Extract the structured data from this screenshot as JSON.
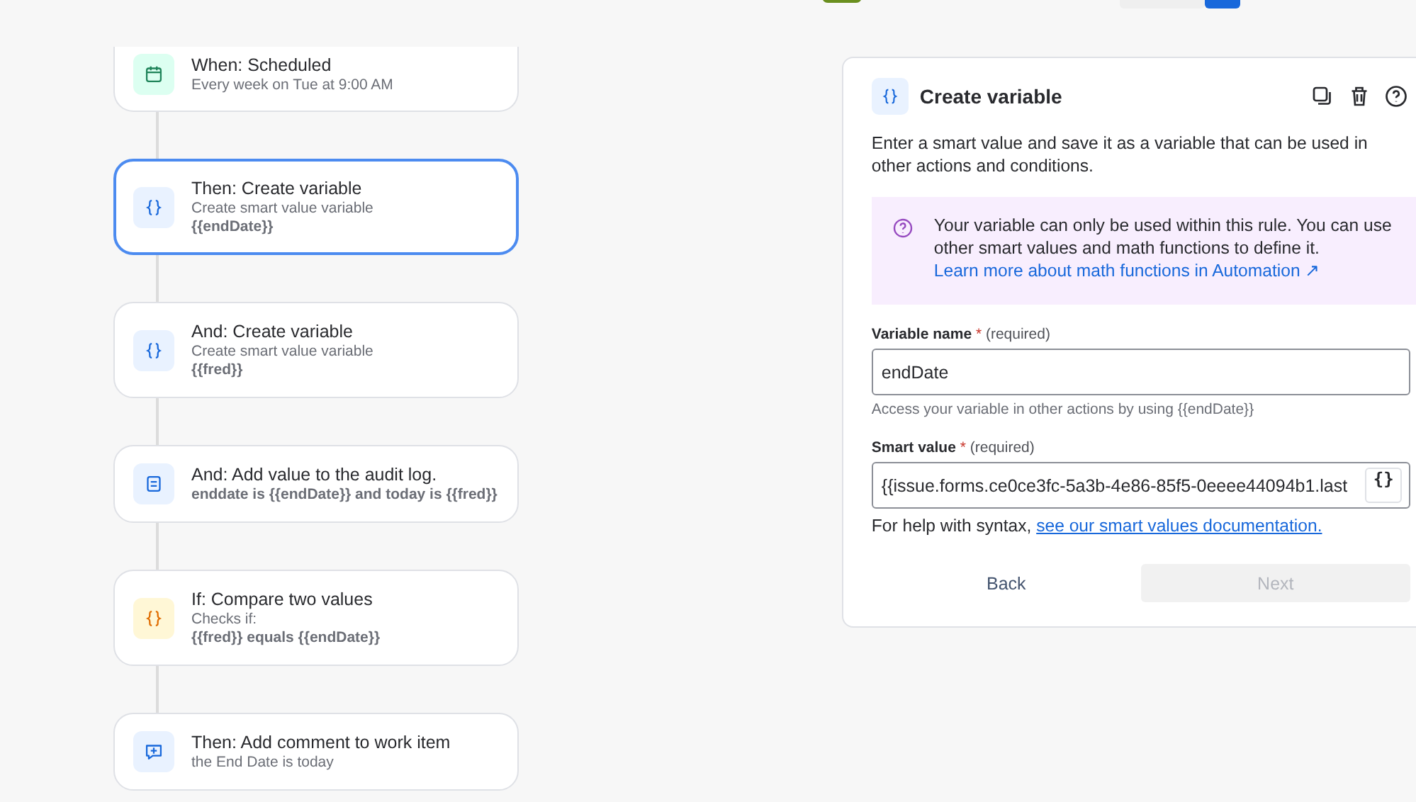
{
  "steps": [
    {
      "kind": "schedule",
      "title": "When: Scheduled",
      "selected": false,
      "lines": [
        {
          "text": "Every week on Tue at 9:00 AM",
          "bold": false
        }
      ]
    },
    {
      "kind": "variable",
      "title": "Then: Create variable",
      "selected": true,
      "lines": [
        {
          "text": "Create smart value variable",
          "bold": false
        },
        {
          "text": "{{endDate}}",
          "bold": true
        }
      ]
    },
    {
      "kind": "variable",
      "title": "And: Create variable",
      "selected": false,
      "lines": [
        {
          "text": "Create smart value variable",
          "bold": false
        },
        {
          "text": "{{fred}}",
          "bold": true
        }
      ]
    },
    {
      "kind": "log",
      "title": "And: Add value to the audit log.",
      "selected": false,
      "lines": [
        {
          "text": "enddate is {{endDate}} and today is {{fred}}",
          "bold": true
        }
      ]
    },
    {
      "kind": "condition",
      "title": "If: Compare two values",
      "selected": false,
      "lines": [
        {
          "text": "Checks if:",
          "bold": false
        },
        {
          "text": "{{fred}} equals {{endDate}}",
          "bold": true
        }
      ]
    },
    {
      "kind": "comment",
      "title": "Then: Add comment to work item",
      "selected": false,
      "lines": [
        {
          "text": "the End Date is today",
          "bold": false
        }
      ]
    }
  ],
  "panel": {
    "title": "Create variable",
    "description": "Enter a smart value and save it as a variable that can be used in other actions and conditions.",
    "info": {
      "text": "Your variable can only be used within this rule. You can use other smart values and math functions to define it.",
      "link": "Learn more about math functions in Automation ↗"
    },
    "fields": [
      {
        "label": "Variable name",
        "required_mark": "*",
        "note": "(required)",
        "value": "endDate",
        "helper": "Access your variable in other actions by using {{endDate}}"
      },
      {
        "label": "Smart value",
        "required_mark": "*",
        "note": "(required)",
        "value": "{{issue.forms.ce0ce3fc-5a3b-4e86-85f5-0eeee44094b1.last",
        "picker": "{}",
        "help_text": "For help with syntax, ",
        "help_link": "see our smart values documentation."
      }
    ],
    "buttons": [
      {
        "label": "Back",
        "disabled": false
      },
      {
        "label": "Next",
        "disabled": true
      }
    ]
  }
}
